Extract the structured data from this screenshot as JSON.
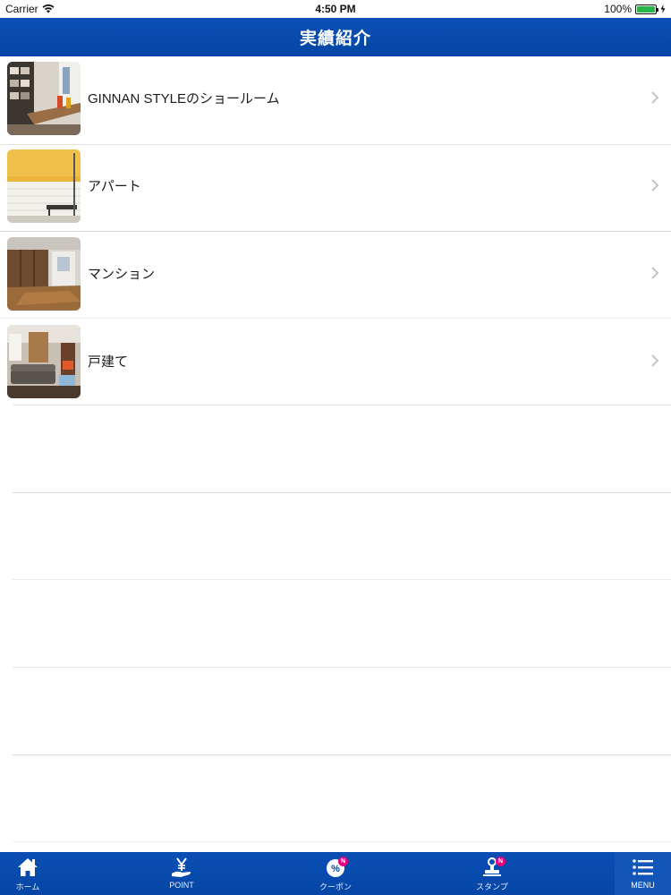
{
  "status_bar": {
    "carrier": "Carrier",
    "time": "4:50 PM",
    "battery": "100%",
    "battery_level": 1.0
  },
  "nav": {
    "title": "実績紹介"
  },
  "list": {
    "items": [
      {
        "label": "GINNAN STYLEのショールーム",
        "icon": "showroom-photo"
      },
      {
        "label": "アパート",
        "icon": "apartment-photo"
      },
      {
        "label": "マンション",
        "icon": "condominium-photo"
      },
      {
        "label": "戸建て",
        "icon": "house-photo"
      }
    ]
  },
  "tab_bar": {
    "tabs": [
      {
        "label": "ホーム",
        "icon": "home-icon"
      },
      {
        "label": "POINT",
        "icon": "point-yen-icon"
      },
      {
        "label": "クーポン",
        "icon": "coupon-icon",
        "badge": "N"
      },
      {
        "label": "スタンプ",
        "icon": "stamp-icon",
        "badge": "N"
      },
      {
        "label": "MENU",
        "icon": "menu-icon"
      }
    ]
  },
  "colors": {
    "nav_blue": "#0546a6",
    "badge_pink": "#e6007e"
  }
}
